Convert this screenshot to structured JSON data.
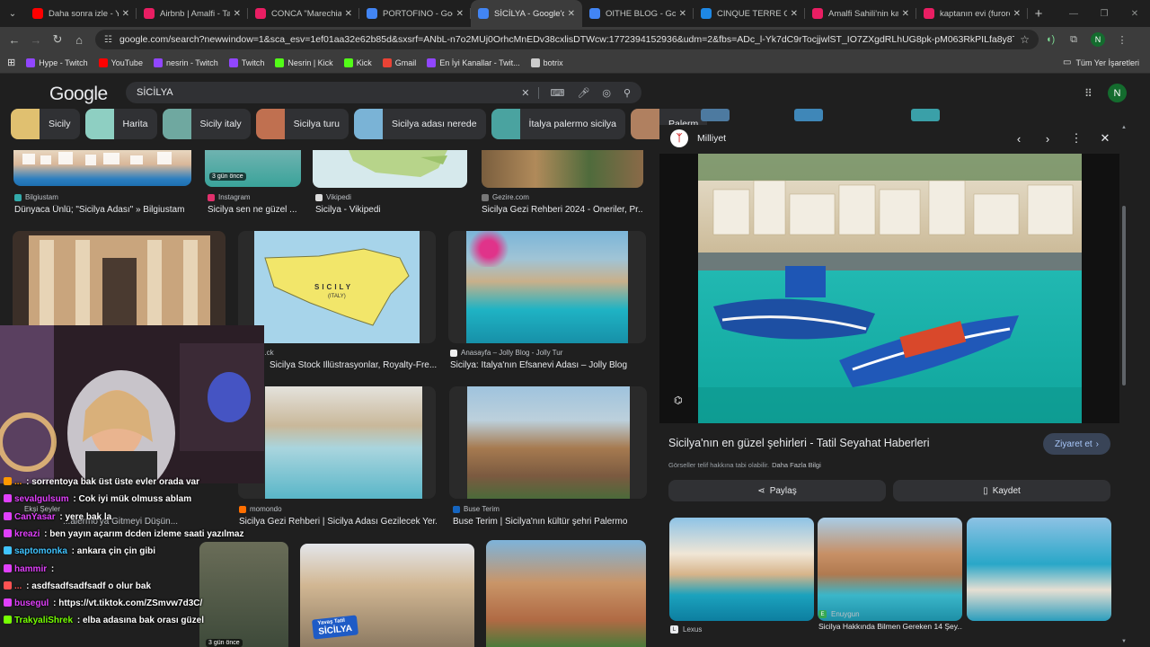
{
  "tabs": [
    {
      "title": "Daha sonra izle - You",
      "fav_color": "#ff0000",
      "active": false
    },
    {
      "title": "Airbnb | Amalfi - Tatil",
      "fav_color": "#e91e63",
      "active": false
    },
    {
      "title": "CONCA \"Marechiaro\"",
      "fav_color": "#e91e63",
      "active": false
    },
    {
      "title": "PORTOFINO - Google",
      "fav_color": "#4285f4",
      "active": false
    },
    {
      "title": "SİCİLYA - Google'da A",
      "fav_color": "#4285f4",
      "active": true
    },
    {
      "title": "OITHE BLOG - Google",
      "fav_color": "#4285f4",
      "active": false
    },
    {
      "title": "CINQUE TERRE GEZİ",
      "fav_color": "#1e88e5",
      "active": false
    },
    {
      "title": "Amalfi Sahili'nin kalb",
      "fav_color": "#e91e63",
      "active": false
    },
    {
      "title": "kaptanın evi (furore a",
      "fav_color": "#e91e63",
      "active": false
    }
  ],
  "address": {
    "url": "google.com/search?newwindow=1&sca_esv=1ef01aa32e62b85d&sxsrf=ANbL-n7o2MUj0OrhcMnEDv38cxlisDTWcw:1772394152936&udm=2&fbs=ADc_l-Yk7dC9rTocjjwlST_IO7ZXgdRLhUG8pk-pM063RkPILfa8y8TDcNYX0oihjHX-_gadUwZ3S_Ee..."
  },
  "bookmarks": [
    {
      "label": "Hype - Twitch",
      "color": "#9146ff"
    },
    {
      "label": "YouTube",
      "color": "#ff0000"
    },
    {
      "label": "nesrin - Twitch",
      "color": "#9146ff"
    },
    {
      "label": "Twitch",
      "color": "#9146ff"
    },
    {
      "label": "Nesrin | Kick",
      "color": "#53fc18"
    },
    {
      "label": "Kick",
      "color": "#53fc18"
    },
    {
      "label": "Gmail",
      "color": "#ea4335"
    },
    {
      "label": "En İyi Kanallar - Twit...",
      "color": "#9146ff"
    },
    {
      "label": "botrix",
      "color": "#cccccc"
    }
  ],
  "bookmarks_right": "Tüm Yer İşaretleri",
  "profile_initial": "N",
  "google": {
    "logo": "Google",
    "query": "SİCİLYA",
    "avatar": "N"
  },
  "chips": [
    {
      "label": "Sicily",
      "color": "#e0c070"
    },
    {
      "label": "Harita",
      "color": "#8ecfc2"
    },
    {
      "label": "Sicily italy",
      "color": "#6fa8a0"
    },
    {
      "label": "Sicilya turu",
      "color": "#c07050"
    },
    {
      "label": "Sicilya adası nerede",
      "color": "#7ab3d6"
    },
    {
      "label": "İtalya palermo sicilya",
      "color": "#4aa3a0"
    },
    {
      "label": "Palerm",
      "color": "#b08060"
    }
  ],
  "results_row1": [
    {
      "source": "Bilgiustam",
      "caption": "Dünyaca Ünlü; \"Sicilya Adası\" » Bilgiustam",
      "src_color": "#3aa"
    },
    {
      "source": "Instagram",
      "caption": "Sicilya sen ne güzel ...",
      "src_color": "#e1306c",
      "badge": "3 gün önce"
    },
    {
      "source": "Vikipedi",
      "caption": "Sicilya - Vikipedi",
      "src_color": "#ddd"
    },
    {
      "source": "Gezire.com",
      "caption": "Sicilya Gezi Rehberi 2024 - Öneriler, Pr...",
      "src_color": "#777"
    }
  ],
  "results_row2": [
    {
      "source": "...ck",
      "caption": "Sicilya Stock İllüstrasyonlar, Royalty-Fre..."
    },
    {
      "source": "Anasayfa – Jolly Blog - Jolly Tur",
      "caption": "Sicilya: İtalya'nın Efsanevi Adası – Jolly Blog"
    }
  ],
  "results_row3": [
    {
      "source": "Ekşi Şeyler",
      "caption": "...alermo'ya Gitmeyi Düşün..."
    },
    {
      "source": "momondo",
      "caption": "Sicilya Gezi Rehberi | Sicilya Adası Gezilecek Yer..."
    },
    {
      "source": "Buse Terim",
      "caption": "Buse Terim | Sicilya'nın kültür şehri Palermo"
    }
  ],
  "results_row4_badge": "3 gün önce",
  "results_row4_banner": [
    "Yavaş Tatil",
    "SİCİLYA"
  ],
  "sicily_map_label": "SICILY",
  "sicily_map_sub": "(ITALY)",
  "panel": {
    "publisher": "Milliyet",
    "title": "Sicilya'nın en güzel şehirleri - Tatil Seyahat Haberleri",
    "visit": "Ziyaret et",
    "copyright": "Görseller telif hakkına tabi olabilir.",
    "more_info": "Daha Fazla Bilgi",
    "share": "Paylaş",
    "save": "Kaydet",
    "related": [
      {
        "source": "Lexus",
        "caption": ""
      },
      {
        "source": "Enuygun",
        "caption": "Sicilya Hakkında Bilmen Gereken 14 Şey..."
      },
      {
        "source": "",
        "caption": ""
      }
    ]
  },
  "chat": [
    {
      "user": "...",
      "text": "sorrentoya bak üst üste evler orada var",
      "color": "#ff9800"
    },
    {
      "user": "sevalgulsum",
      "text": "Cok iyi mük olmuss ablam",
      "color": "#e040fb"
    },
    {
      "user": "CanYasar",
      "text": "yere bak la",
      "color": "#e040fb"
    },
    {
      "user": "kreazi",
      "text": "ben yayın açarım dcden izleme saati yazılmaz",
      "color": "#e040fb"
    },
    {
      "user": "saptomonka",
      "text": "ankara çin çin gibi",
      "color": "#40c4ff"
    },
    {
      "user": "hammir",
      "text": "",
      "color": "#e040fb"
    },
    {
      "user": "...",
      "text": "asdfsadfsadfsadf o olur bak",
      "color": "#ff5252"
    },
    {
      "user": "busegul",
      "text": "https://vt.tiktok.com/ZSmvw7d3C/",
      "color": "#e040fb"
    },
    {
      "user": "TrakyaliShrek",
      "text": "elba adasına bak orası güzel",
      "color": "#76ff03"
    }
  ]
}
